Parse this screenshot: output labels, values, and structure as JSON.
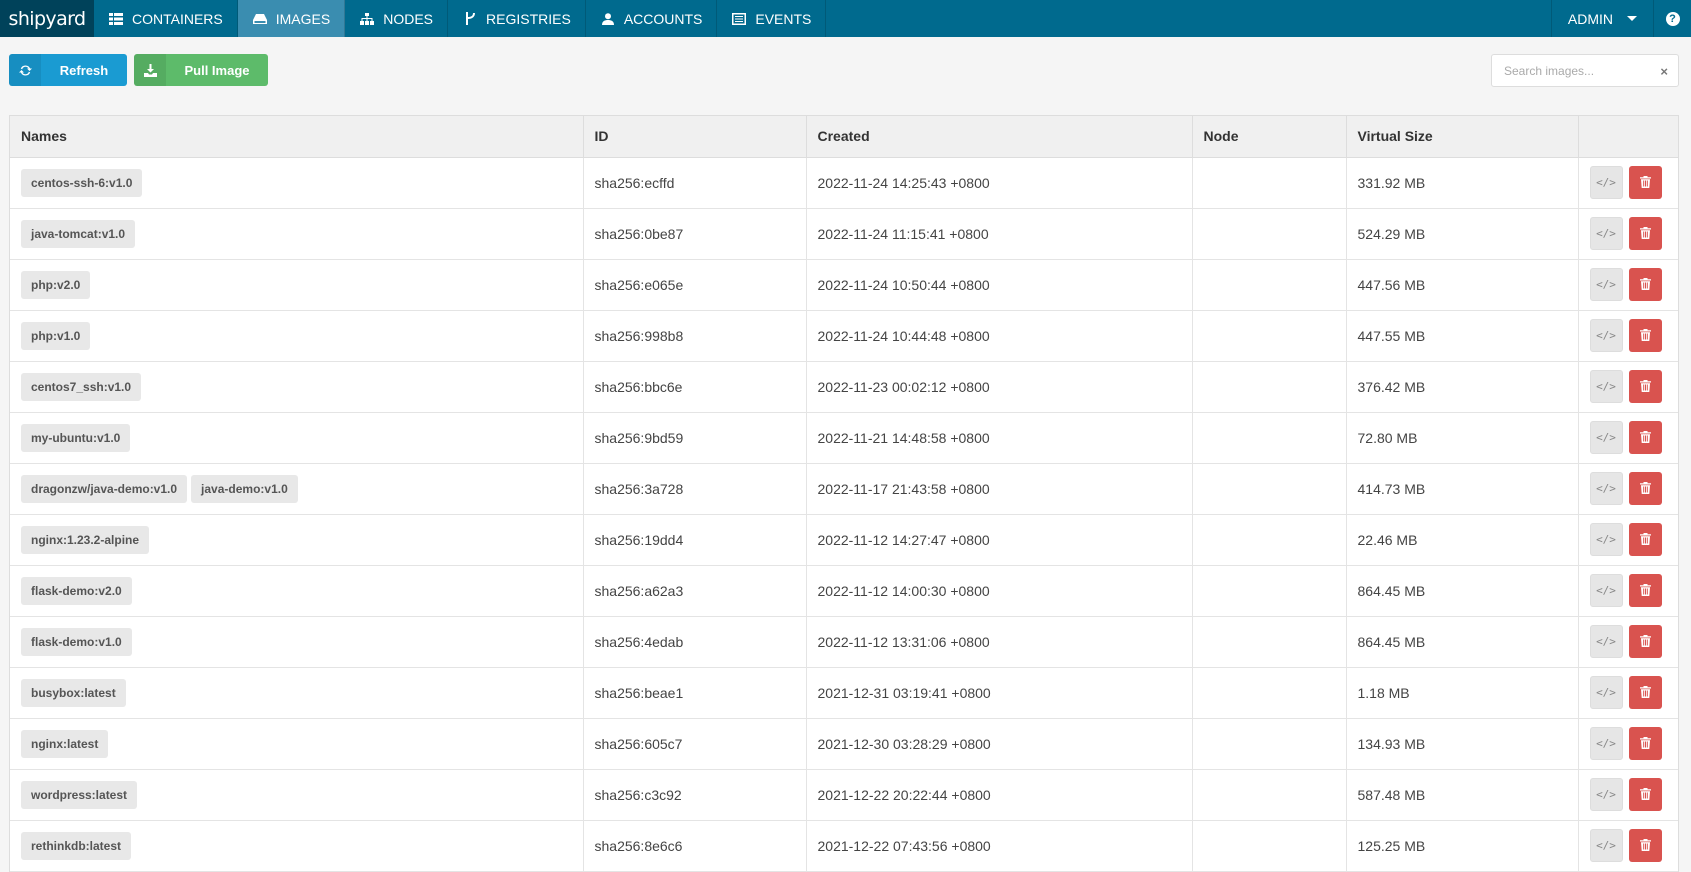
{
  "nav": {
    "brand": "shipyard",
    "items": [
      {
        "label": "CONTAINERS",
        "icon": "table-icon",
        "active": false
      },
      {
        "label": "IMAGES",
        "icon": "hdd-icon",
        "active": true
      },
      {
        "label": "NODES",
        "icon": "sitemap-icon",
        "active": false
      },
      {
        "label": "REGISTRIES",
        "icon": "branch-icon",
        "active": false
      },
      {
        "label": "ACCOUNTS",
        "icon": "user-icon",
        "active": false
      },
      {
        "label": "EVENTS",
        "icon": "list-icon",
        "active": false
      }
    ],
    "user": "ADMIN",
    "help": "?"
  },
  "toolbar": {
    "refresh_label": "Refresh",
    "pull_label": "Pull Image",
    "search_placeholder": "Search images...",
    "search_clear": "×"
  },
  "table": {
    "columns": [
      "Names",
      "ID",
      "Created",
      "Node",
      "Virtual Size",
      ""
    ],
    "inspect_glyph": "</>",
    "rows": [
      {
        "names": [
          "centos-ssh-6:v1.0"
        ],
        "id": "sha256:ecffd",
        "created": "2022-11-24 14:25:43 +0800",
        "node": "",
        "size": "331.92 MB"
      },
      {
        "names": [
          "java-tomcat:v1.0"
        ],
        "id": "sha256:0be87",
        "created": "2022-11-24 11:15:41 +0800",
        "node": "",
        "size": "524.29 MB"
      },
      {
        "names": [
          "php:v2.0"
        ],
        "id": "sha256:e065e",
        "created": "2022-11-24 10:50:44 +0800",
        "node": "",
        "size": "447.56 MB"
      },
      {
        "names": [
          "php:v1.0"
        ],
        "id": "sha256:998b8",
        "created": "2022-11-24 10:44:48 +0800",
        "node": "",
        "size": "447.55 MB"
      },
      {
        "names": [
          "centos7_ssh:v1.0"
        ],
        "id": "sha256:bbc6e",
        "created": "2022-11-23 00:02:12 +0800",
        "node": "",
        "size": "376.42 MB"
      },
      {
        "names": [
          "my-ubuntu:v1.0"
        ],
        "id": "sha256:9bd59",
        "created": "2022-11-21 14:48:58 +0800",
        "node": "",
        "size": "72.80 MB"
      },
      {
        "names": [
          "dragonzw/java-demo:v1.0",
          "java-demo:v1.0"
        ],
        "id": "sha256:3a728",
        "created": "2022-11-17 21:43:58 +0800",
        "node": "",
        "size": "414.73 MB"
      },
      {
        "names": [
          "nginx:1.23.2-alpine"
        ],
        "id": "sha256:19dd4",
        "created": "2022-11-12 14:27:47 +0800",
        "node": "",
        "size": "22.46 MB"
      },
      {
        "names": [
          "flask-demo:v2.0"
        ],
        "id": "sha256:a62a3",
        "created": "2022-11-12 14:00:30 +0800",
        "node": "",
        "size": "864.45 MB"
      },
      {
        "names": [
          "flask-demo:v1.0"
        ],
        "id": "sha256:4edab",
        "created": "2022-11-12 13:31:06 +0800",
        "node": "",
        "size": "864.45 MB"
      },
      {
        "names": [
          "busybox:latest"
        ],
        "id": "sha256:beae1",
        "created": "2021-12-31 03:19:41 +0800",
        "node": "",
        "size": "1.18 MB"
      },
      {
        "names": [
          "nginx:latest"
        ],
        "id": "sha256:605c7",
        "created": "2021-12-30 03:28:29 +0800",
        "node": "",
        "size": "134.93 MB"
      },
      {
        "names": [
          "wordpress:latest"
        ],
        "id": "sha256:c3c92",
        "created": "2021-12-22 20:22:44 +0800",
        "node": "",
        "size": "587.48 MB"
      },
      {
        "names": [
          "rethinkdb:latest"
        ],
        "id": "sha256:8e6c6",
        "created": "2021-12-22 07:43:56 +0800",
        "node": "",
        "size": "125.25 MB"
      }
    ]
  },
  "colors": {
    "navbar": "#006a8e",
    "brand_bg": "#00425a",
    "active_tab": "#3a8db0",
    "refresh": "#1a9bd2",
    "pull": "#5dbb6a",
    "delete": "#d9534f"
  }
}
